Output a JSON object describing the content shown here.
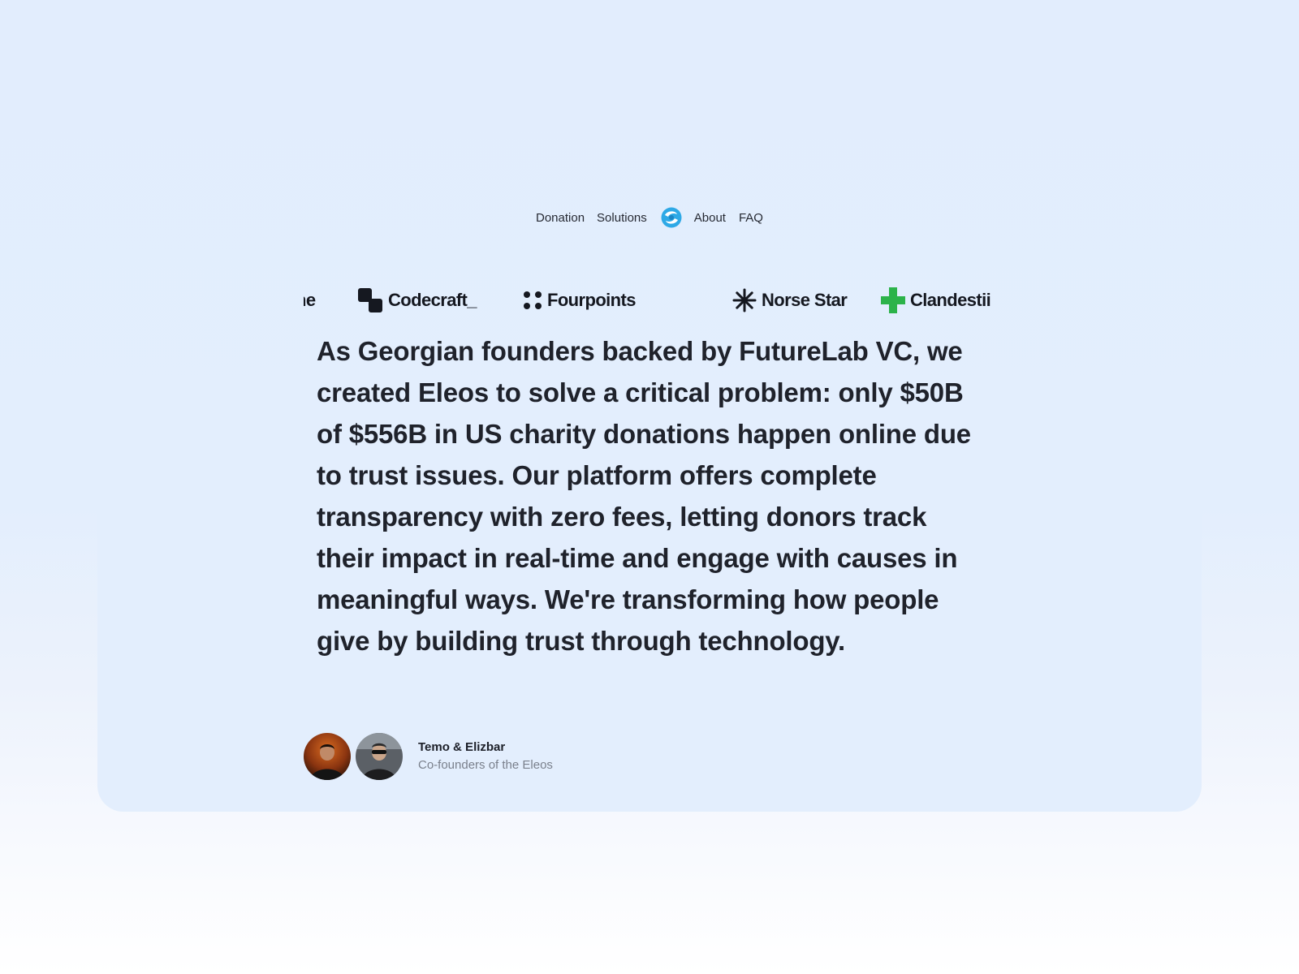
{
  "nav": {
    "links": [
      "Donation",
      "Solutions",
      "About",
      "FAQ"
    ],
    "logo_icon": "eleos-logo-icon",
    "logo_color": "#2aa8e8"
  },
  "brands": [
    {
      "name": "ne",
      "icon": "none"
    },
    {
      "name": "Codecraft_",
      "icon": "codecraft-icon"
    },
    {
      "name": "Fourpoints",
      "icon": "four-dots-icon"
    },
    {
      "name": "Norse Star",
      "icon": "asterisk-star-icon"
    },
    {
      "name": "Clandestii",
      "icon": "green-cross-icon",
      "icon_color": "#2cb34a"
    }
  ],
  "testimonial": {
    "quote": "As Georgian founders backed by FutureLab VC, we created Eleos to solve a critical problem: only $50B of $556B in US charity donations happen online due to trust issues. Our platform offers complete transparency with zero fees, letting donors track their impact in real-time and engage with causes in meaningful ways. We're transforming how people give by building trust through technology.",
    "author_names": "Temo & Elizbar",
    "author_role": "Co-founders of the Eleos"
  }
}
